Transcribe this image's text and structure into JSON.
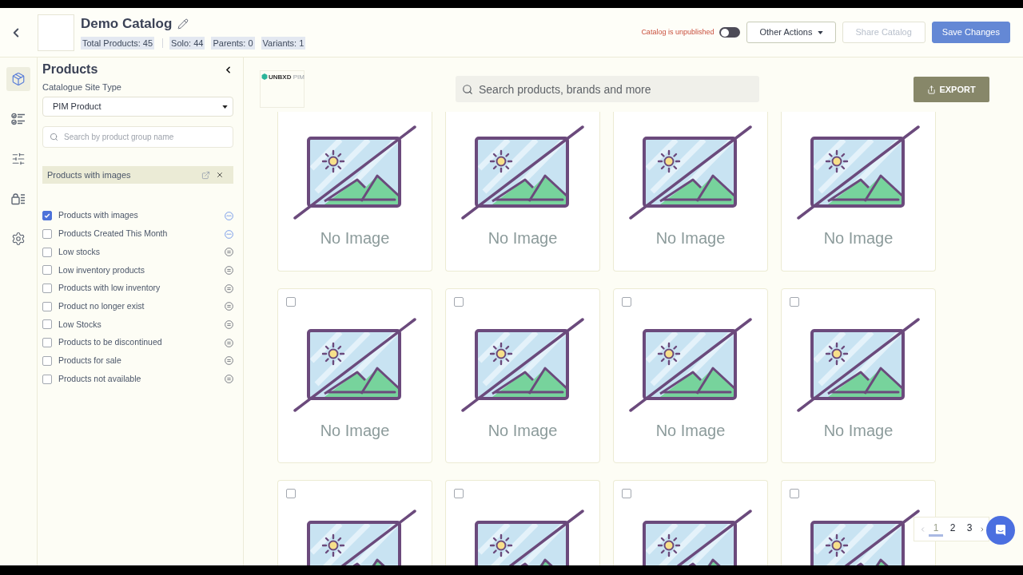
{
  "header": {
    "title": "Demo Catalog",
    "stats": [
      "Total Products: 45",
      "Solo: 44",
      "Parents: 0",
      "Variants: 1"
    ],
    "publish_status": "Catalog is unpublished",
    "published": false,
    "buttons": [
      {
        "label": "Other Actions",
        "kind": "menu",
        "disabled": false
      },
      {
        "label": "Share Catalog",
        "kind": "outline",
        "disabled": true
      },
      {
        "label": "Save Changes",
        "kind": "primary",
        "disabled": false
      }
    ]
  },
  "rail": {
    "items": [
      {
        "kind": "box",
        "selected": true
      },
      {
        "kind": "checklist",
        "selected": false
      },
      {
        "kind": "sliders",
        "selected": false
      },
      {
        "kind": "lock-list",
        "selected": false
      },
      {
        "kind": "gear",
        "selected": false
      }
    ]
  },
  "sidebar": {
    "title": "Products",
    "site_type_label": "Catalogue Site Type",
    "site_type": "PIM Product",
    "search": {
      "placeholder": "Search by product group name"
    },
    "active_filter": "Products with images",
    "filters": [
      {
        "label": "Products with images",
        "checked": true,
        "kind": "trend"
      },
      {
        "label": "Products Created This Month",
        "checked": false,
        "kind": "trend"
      },
      {
        "label": "Low stocks",
        "checked": false,
        "kind": "list"
      },
      {
        "label": "Low inventory products",
        "checked": false,
        "kind": "list"
      },
      {
        "label": "Products with low inventory",
        "checked": false,
        "kind": "list"
      },
      {
        "label": "Product no longer exist",
        "checked": false,
        "kind": "list"
      },
      {
        "label": "Low Stocks",
        "checked": false,
        "kind": "list"
      },
      {
        "label": "Products to be discontinued",
        "checked": false,
        "kind": "list"
      },
      {
        "label": "Products for sale",
        "checked": false,
        "kind": "list"
      },
      {
        "label": "Products not available",
        "checked": false,
        "kind": "list"
      }
    ]
  },
  "storefront": {
    "logo": {
      "brand": "UNBXD",
      "suffix": "PIM"
    },
    "search": {
      "placeholder": "Search products, brands and more"
    },
    "export_button": "EXPORT"
  },
  "products": [
    {
      "image_label": "No Image"
    },
    {
      "image_label": "No Image"
    },
    {
      "image_label": "No Image"
    },
    {
      "image_label": "No Image"
    },
    {
      "checked": false,
      "image_label": "No Image"
    },
    {
      "checked": false,
      "image_label": "No Image"
    },
    {
      "checked": false,
      "image_label": "No Image"
    },
    {
      "checked": false,
      "image_label": "No Image"
    },
    {
      "checked": false
    },
    {
      "checked": false
    },
    {
      "checked": false
    },
    {
      "checked": false
    }
  ],
  "pagination": {
    "pages": [
      {
        "label": "1",
        "selected": true
      },
      {
        "label": "2",
        "selected": false
      },
      {
        "label": "3",
        "selected": false
      }
    ]
  }
}
